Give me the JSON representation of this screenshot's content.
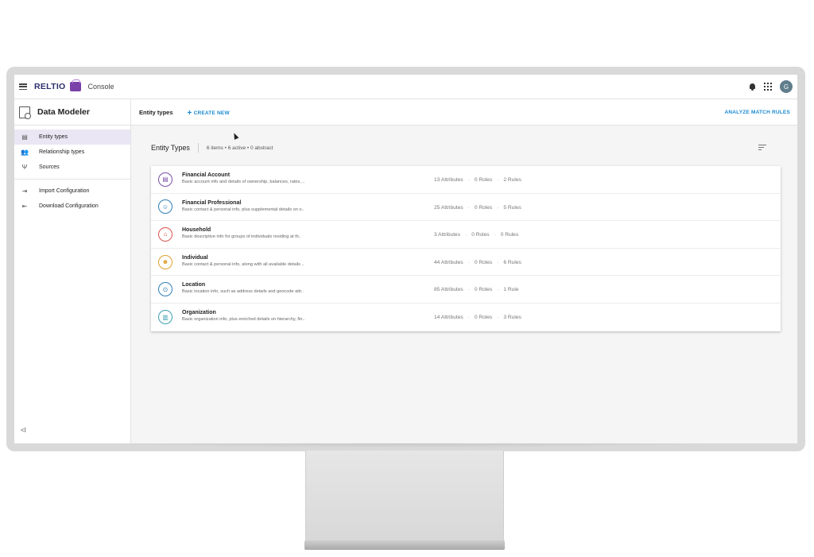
{
  "topbar": {
    "brand": "RELTIO",
    "app": "Console",
    "avatar_initial": "G"
  },
  "sidebar": {
    "title": "Data Modeler",
    "items": [
      {
        "label": "Entity types",
        "icon": "entity-icon",
        "active": true
      },
      {
        "label": "Relationship types",
        "icon": "people-icon"
      },
      {
        "label": "Sources",
        "icon": "sources-icon"
      }
    ],
    "config": [
      {
        "label": "Import Configuration",
        "icon": "import-icon"
      },
      {
        "label": "Download Configuration",
        "icon": "download-icon"
      }
    ],
    "collapse": "<I"
  },
  "header": {
    "title": "Entity types",
    "create_label": "CREATE NEW",
    "analyze_label": "ANALYZE MATCH RULES"
  },
  "section": {
    "title": "Entity Types",
    "meta": "6 items • 6 active • 0 abstract"
  },
  "entities": [
    {
      "name": "Financial Account",
      "desc": "Basic account info and details of ownership, balances, rates, ..",
      "attrs": "13 Attributes",
      "roles": "0 Roles",
      "rules": "2 Rules",
      "color": "#7b4fa6",
      "icon": "account-icon",
      "glyph": "▤"
    },
    {
      "name": "Financial Professional",
      "desc": "Basic contact & personal info, plus supplemental details on o..",
      "attrs": "25 Attributes",
      "roles": "0 Roles",
      "rules": "5 Rules",
      "color": "#2e7fb8",
      "icon": "professional-icon",
      "glyph": "☺"
    },
    {
      "name": "Household",
      "desc": "Basic descriptive info for groups of individuals residing at th..",
      "attrs": "3 Attributes",
      "roles": "0 Roles",
      "rules": "0 Rules",
      "color": "#d9534f",
      "icon": "household-icon",
      "glyph": "⌂"
    },
    {
      "name": "Individual",
      "desc": "Basic contact & personal info, along with all available details ..",
      "attrs": "44 Attributes",
      "roles": "0 Roles",
      "rules": "6 Rules",
      "color": "#e0a030",
      "icon": "individual-icon",
      "glyph": "☻"
    },
    {
      "name": "Location",
      "desc": "Basic location info, such as address details and geocode attr..",
      "attrs": "85 Attributes",
      "roles": "0 Roles",
      "rules": "1 Rule",
      "color": "#2e7fb8",
      "icon": "location-icon",
      "glyph": "⊙"
    },
    {
      "name": "Organization",
      "desc": "Basic organization info, plus enriched details on hierarchy, fin..",
      "attrs": "14 Attributes",
      "roles": "0 Roles",
      "rules": "3 Rules",
      "color": "#3a9fb0",
      "icon": "organization-icon",
      "glyph": "▥"
    }
  ]
}
